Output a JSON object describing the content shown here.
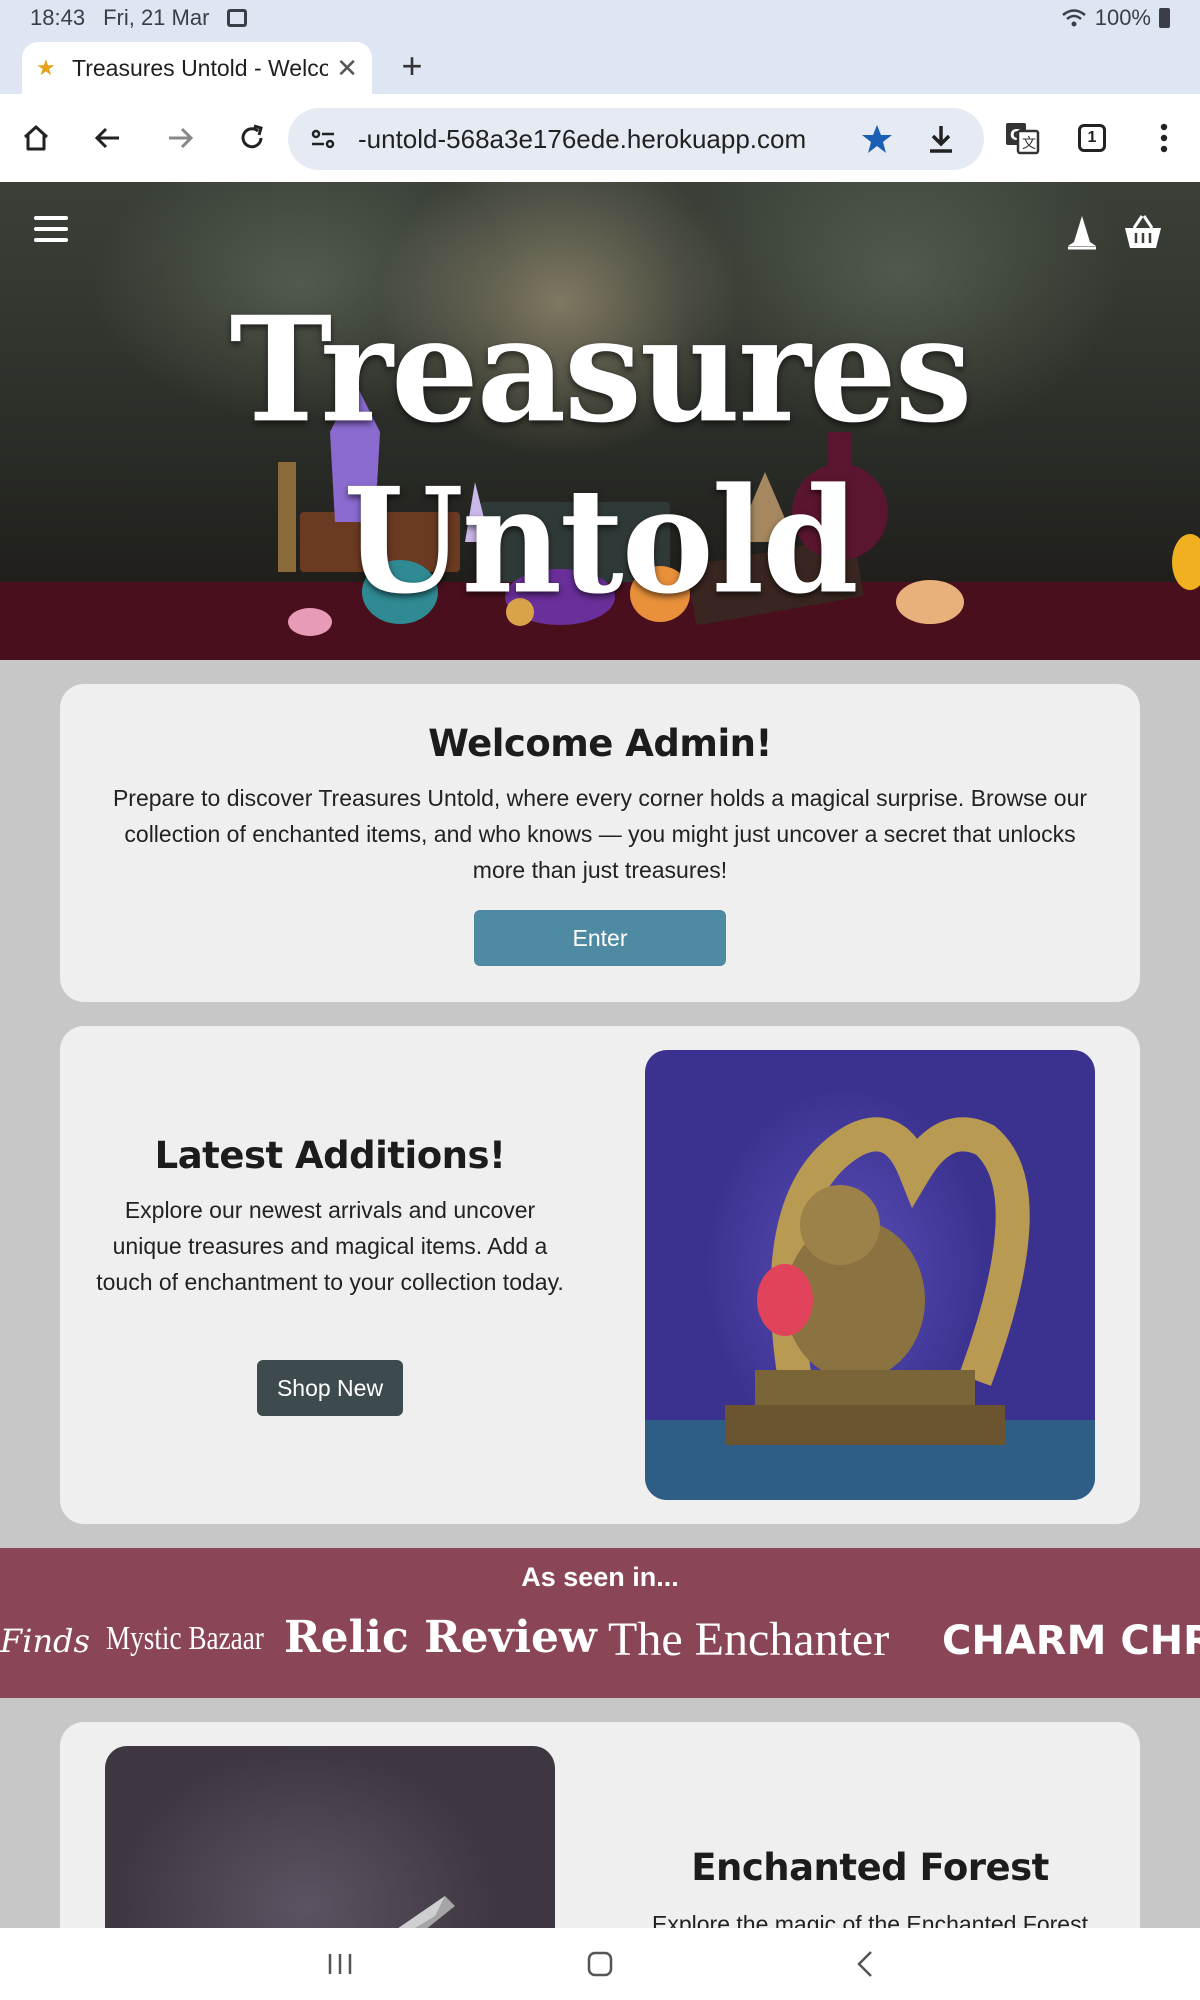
{
  "status_bar": {
    "time": "18:43",
    "date": "Fri, 21 Mar",
    "battery": "100%"
  },
  "browser": {
    "tab_title": "Treasures Untold - Welcome",
    "url": "-untold-568a3e176ede.herokuapp.com",
    "tab_count": "1"
  },
  "hero": {
    "title": "Treasures Untold"
  },
  "welcome": {
    "heading": "Welcome Admin!",
    "text": "Prepare to discover Treasures Untold, where every corner holds a magical surprise. Browse our collection of enchanted items, and who knows — you might just uncover a secret that unlocks more than just treasures!",
    "button": "Enter"
  },
  "latest": {
    "heading": "Latest Additions!",
    "text": "Explore our newest arrivals and uncover unique treasures and magical items. Add a touch of enchantment to your collection today.",
    "button": "Shop New"
  },
  "press": {
    "label": "As seen in...",
    "logos": [
      "Finds",
      "Mystic Bazaar",
      "Relic Review",
      "The Enchanter",
      "CHARM CHRON"
    ]
  },
  "forest": {
    "heading": "Enchanted Forest",
    "text": "Explore the magic of the Enchanted Forest"
  }
}
